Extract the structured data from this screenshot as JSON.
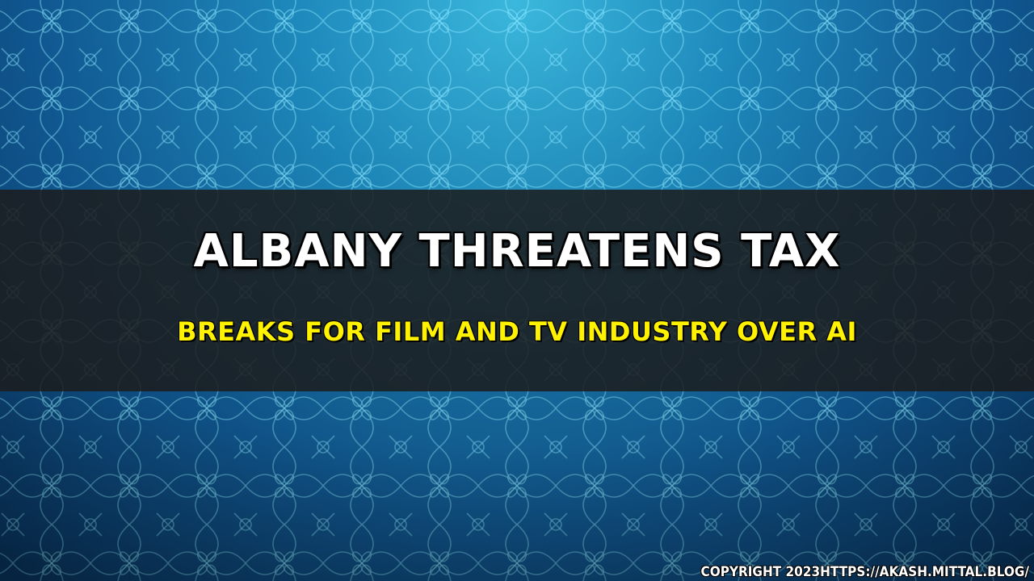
{
  "headline": {
    "line1": "ALBANY THREATENS TAX",
    "line2": "BREAKS FOR FILM AND TV INDUSTRY OVER AI"
  },
  "footer": {
    "copyright": "COPYRIGHT 2023HTTPS://AKASH.MITTAL.BLOG/"
  },
  "colors": {
    "headline_line1": "#ffffff",
    "headline_line2": "#fff200",
    "band": "#1c1c1c",
    "background_light": "#3bb8dc",
    "background_dark": "#0b3f73"
  },
  "background": {
    "pattern_icon": "ornamental-lattice-pattern"
  }
}
